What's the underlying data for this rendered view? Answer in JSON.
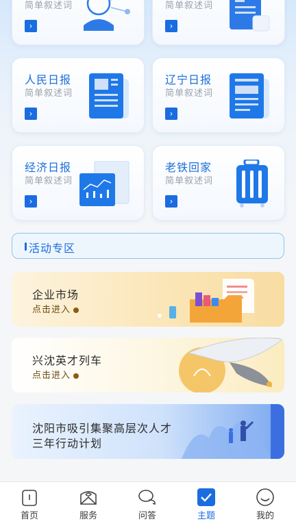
{
  "cards": [
    {
      "title": "",
      "desc": "简单叙述词",
      "icon": "person-network-icon"
    },
    {
      "title": "",
      "desc": "简单叙述词",
      "icon": "newspaper-cup-icon"
    },
    {
      "title": "人民日报",
      "desc": "简单叙述词",
      "icon": "newspaper-icon"
    },
    {
      "title": "辽宁日报",
      "desc": "简单叙述词",
      "icon": "newspaper-icon"
    },
    {
      "title": "经济日报",
      "desc": "简单叙述词",
      "icon": "stock-chart-icon"
    },
    {
      "title": "老铁回家",
      "desc": "简单叙述词",
      "icon": "suitcase-icon"
    }
  ],
  "arrow_glyph": "›",
  "section": {
    "title": "活动专区"
  },
  "banners": [
    {
      "title": "企业市场",
      "subtitle": "点击进入"
    },
    {
      "title": "兴沈英才列车",
      "subtitle": "点击进入"
    },
    {
      "title": "沈阳市吸引集聚高层次人才",
      "title2": "三年行动计划"
    }
  ],
  "tabs": [
    {
      "label": "首页",
      "icon": "home-icon"
    },
    {
      "label": "服务",
      "icon": "service-icon"
    },
    {
      "label": "问答",
      "icon": "chat-icon"
    },
    {
      "label": "主题",
      "icon": "checkmark-icon",
      "active": true
    },
    {
      "label": "我的",
      "icon": "profile-icon"
    }
  ],
  "colors": {
    "accent": "#1a6ce0",
    "desc": "#9aa3ad"
  }
}
